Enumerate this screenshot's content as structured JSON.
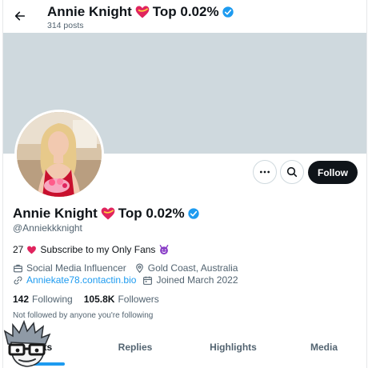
{
  "header": {
    "back_icon": "arrow-left-icon",
    "name": "Annie Knight",
    "badge": "Top 0.02%",
    "posts_count": "314 posts"
  },
  "actions": {
    "more_icon": "ellipsis-icon",
    "search_icon": "search-icon",
    "follow_label": "Follow"
  },
  "profile": {
    "name": "Annie Knight",
    "badge": "Top 0.02%",
    "handle": "@Anniekkknight",
    "bio_age": "27",
    "bio_text": "Subscribe to my Only Fans",
    "category": "Social Media Influencer",
    "location": "Gold Coast, Australia",
    "website": "Anniekate78.contactin.bio",
    "joined": "Joined March 2022"
  },
  "stats": {
    "following_count": "142",
    "following_label": "Following",
    "followers_count": "105.8K",
    "followers_label": "Followers"
  },
  "mutuals_text": "Not followed by anyone you're following",
  "tabs": [
    {
      "label": "Posts",
      "visible_text": "sts",
      "active": true
    },
    {
      "label": "Replies",
      "active": false
    },
    {
      "label": "Highlights",
      "active": false
    },
    {
      "label": "Media",
      "active": false
    }
  ],
  "colors": {
    "accent": "#1d9bf0",
    "verified": "#1d9bf0",
    "banner": "#cfd9de",
    "text": "#0f1419",
    "muted": "#536471"
  }
}
